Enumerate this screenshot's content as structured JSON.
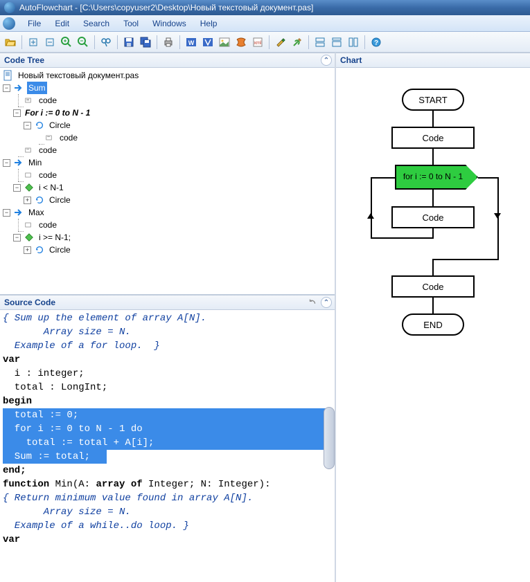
{
  "titlebar": {
    "text": "AutoFlowchart - [C:\\Users\\copyuser2\\Desktop\\Новый текстовый документ.pas]"
  },
  "menubar": {
    "items": [
      "File",
      "Edit",
      "Search",
      "Tool",
      "Windows",
      "Help"
    ]
  },
  "panels": {
    "code_tree": "Code Tree",
    "source_code": "Source Code",
    "chart": "Chart"
  },
  "tree": {
    "root": "Новый текстовый документ.pas",
    "sum": "Sum",
    "sum_code": "code",
    "for_label": "For  i := 0 to N - 1",
    "circle1": "Circle",
    "circle1_code": "code",
    "sum_code2": "code",
    "min": "Min",
    "min_code": "code",
    "min_cond": "i < N-1",
    "min_circle": "Circle",
    "max": "Max",
    "max_code": "code",
    "max_cond": "i >= N-1;",
    "max_circle": "Circle"
  },
  "source": {
    "lines": [
      "{ Sum up the element of array A[N].",
      "       Array size = N.",
      "  Example of a for loop.  }",
      "var",
      "  i : integer;",
      "  total : LongInt;",
      "begin",
      "  total := 0;",
      "  for i := 0 to N - 1 do",
      "    total := total + A[i];",
      "",
      "  Sum := total;",
      "end;",
      "",
      "function Min(A: array of Integer; N: Integer):",
      "{ Return minimum value found in array A[N].",
      "       Array size = N.",
      "  Example of a while..do loop. }",
      "var"
    ]
  },
  "flowchart": {
    "start": "START",
    "code1": "Code",
    "loop": "for i := 0 to N - 1",
    "code2": "Code",
    "code3": "Code",
    "end": "END"
  }
}
